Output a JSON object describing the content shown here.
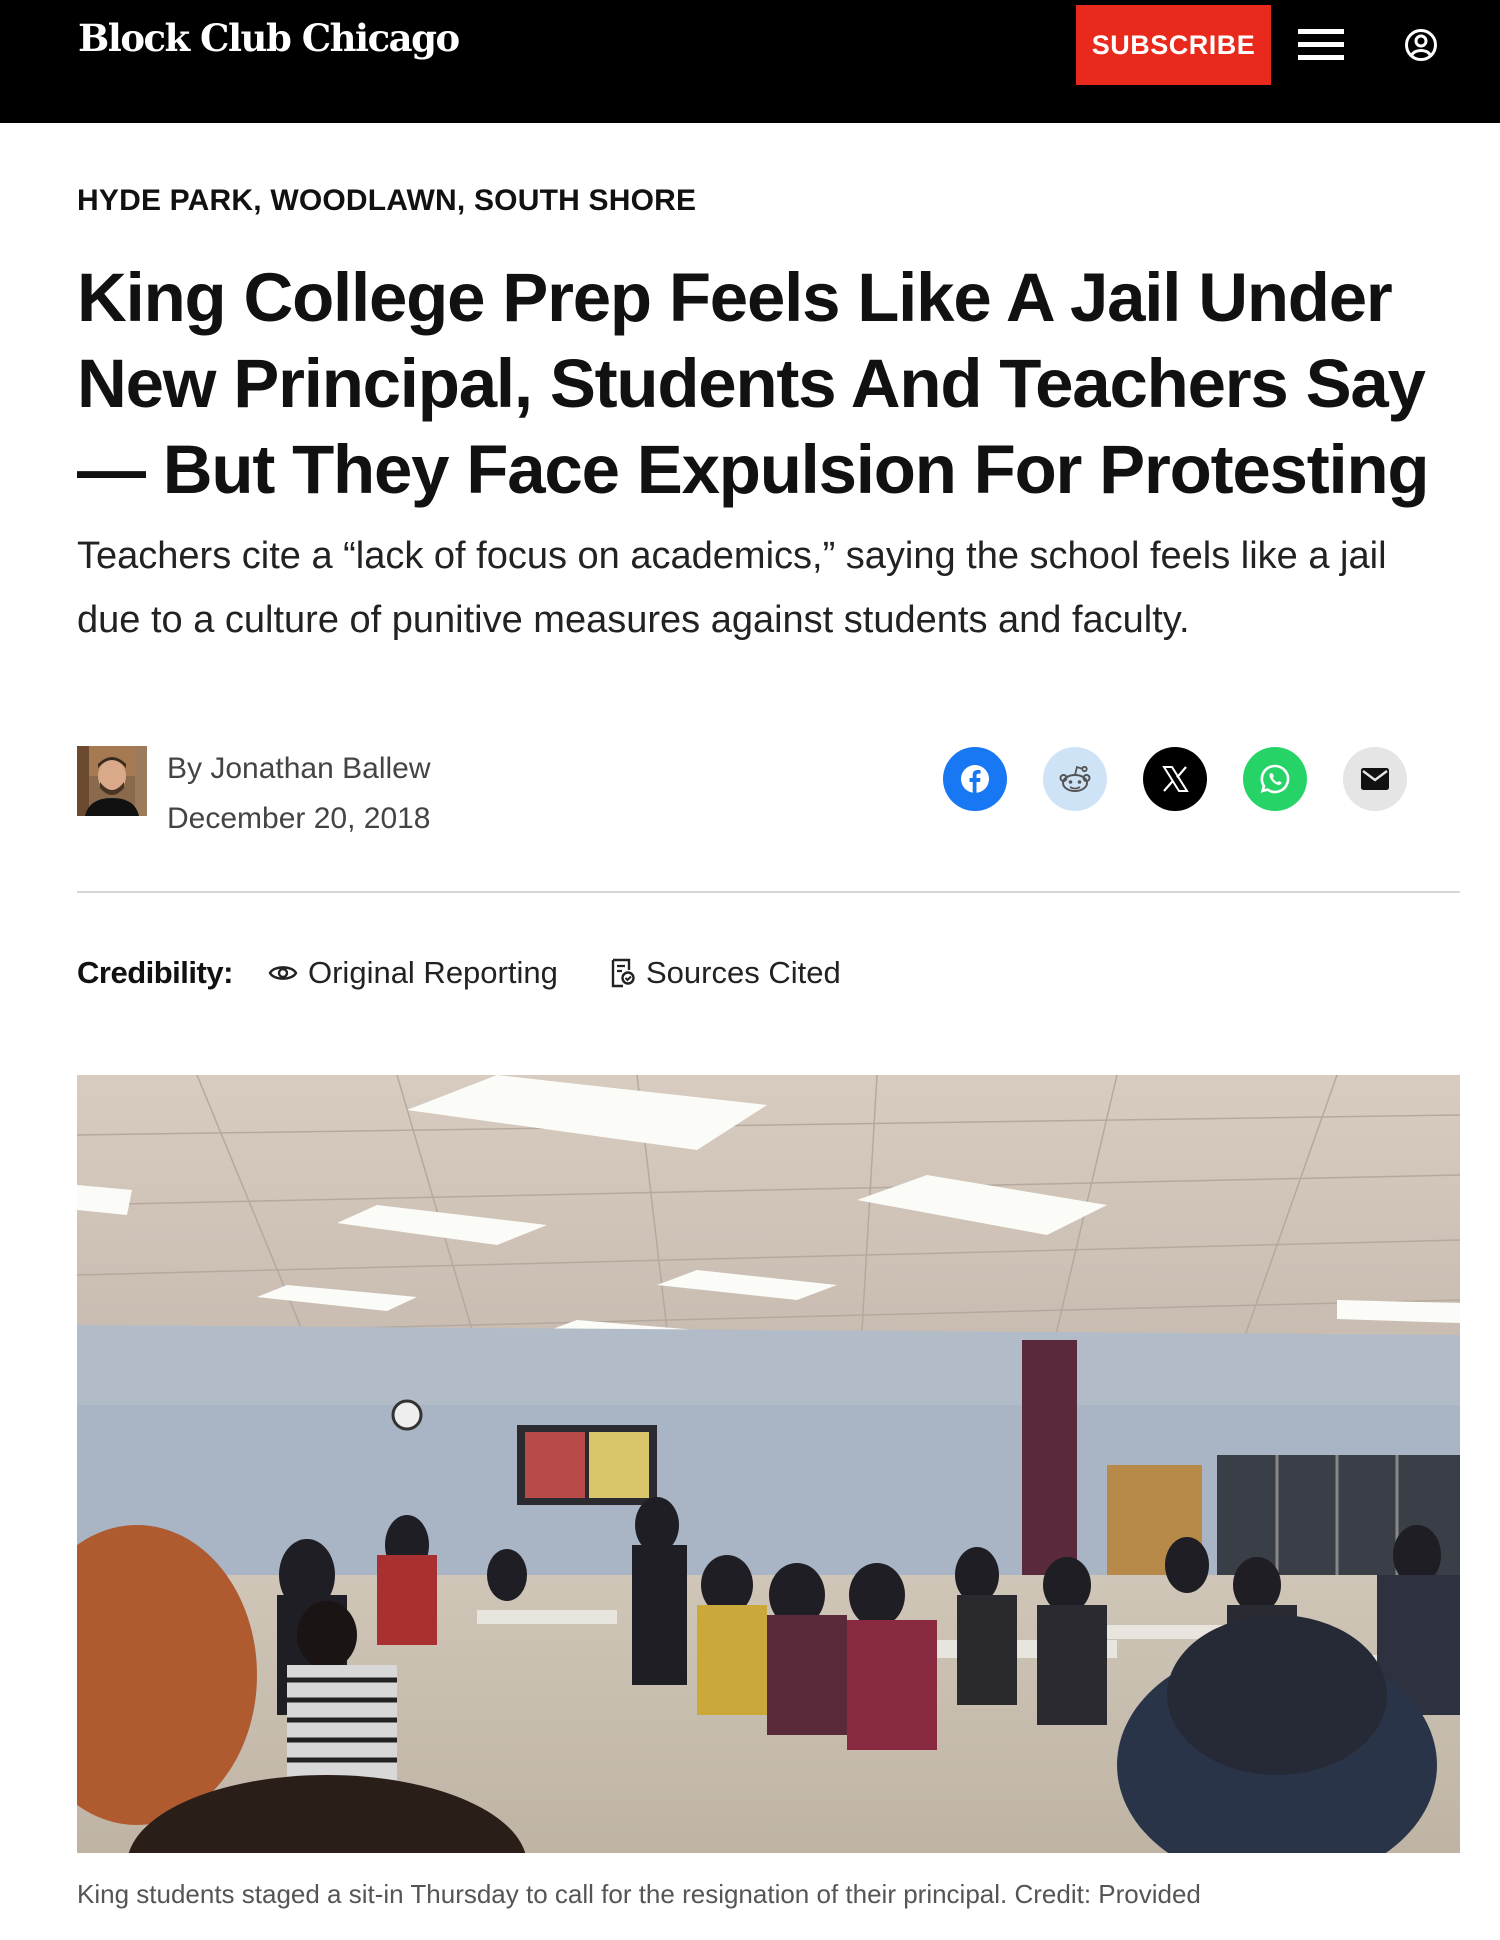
{
  "header": {
    "logo": "Block Club Chicago",
    "subscribe_label": "SUBSCRIBE",
    "menu_icon": "hamburger-menu-icon",
    "account_icon": "user-account-icon"
  },
  "article": {
    "section": "HYDE PARK, WOODLAWN, SOUTH SHORE",
    "headline": "King College Prep Feels Like A Jail Under New Principal, Students And Teachers Say — But They Face Expulsion For Protesting",
    "dek": "Teachers cite a “lack of focus on academics,” saying the school feels like a jail due to a culture of punitive measures against students and faculty.",
    "byline_prefix": "By ",
    "author": "Jonathan Ballew",
    "date": "December 20, 2018"
  },
  "share": {
    "buttons": [
      {
        "name": "facebook",
        "icon": "facebook-icon",
        "color": "#1877f2"
      },
      {
        "name": "reddit",
        "icon": "reddit-icon",
        "color": "#cfe3f7"
      },
      {
        "name": "x",
        "icon": "x-icon",
        "color": "#000000"
      },
      {
        "name": "whatsapp",
        "icon": "whatsapp-icon",
        "color": "#25d366"
      },
      {
        "name": "email",
        "icon": "email-icon",
        "color": "#e5e5e5"
      }
    ]
  },
  "credibility": {
    "label": "Credibility:",
    "items": [
      {
        "label": "Original Reporting",
        "icon": "eye-icon"
      },
      {
        "label": "Sources Cited",
        "icon": "document-icon"
      }
    ]
  },
  "photo": {
    "caption": "King students staged a sit-in Thursday to call for the resignation of their principal. Credit: Provided"
  },
  "colors": {
    "header_bg": "#000000",
    "subscribe_bg": "#e8291c"
  }
}
